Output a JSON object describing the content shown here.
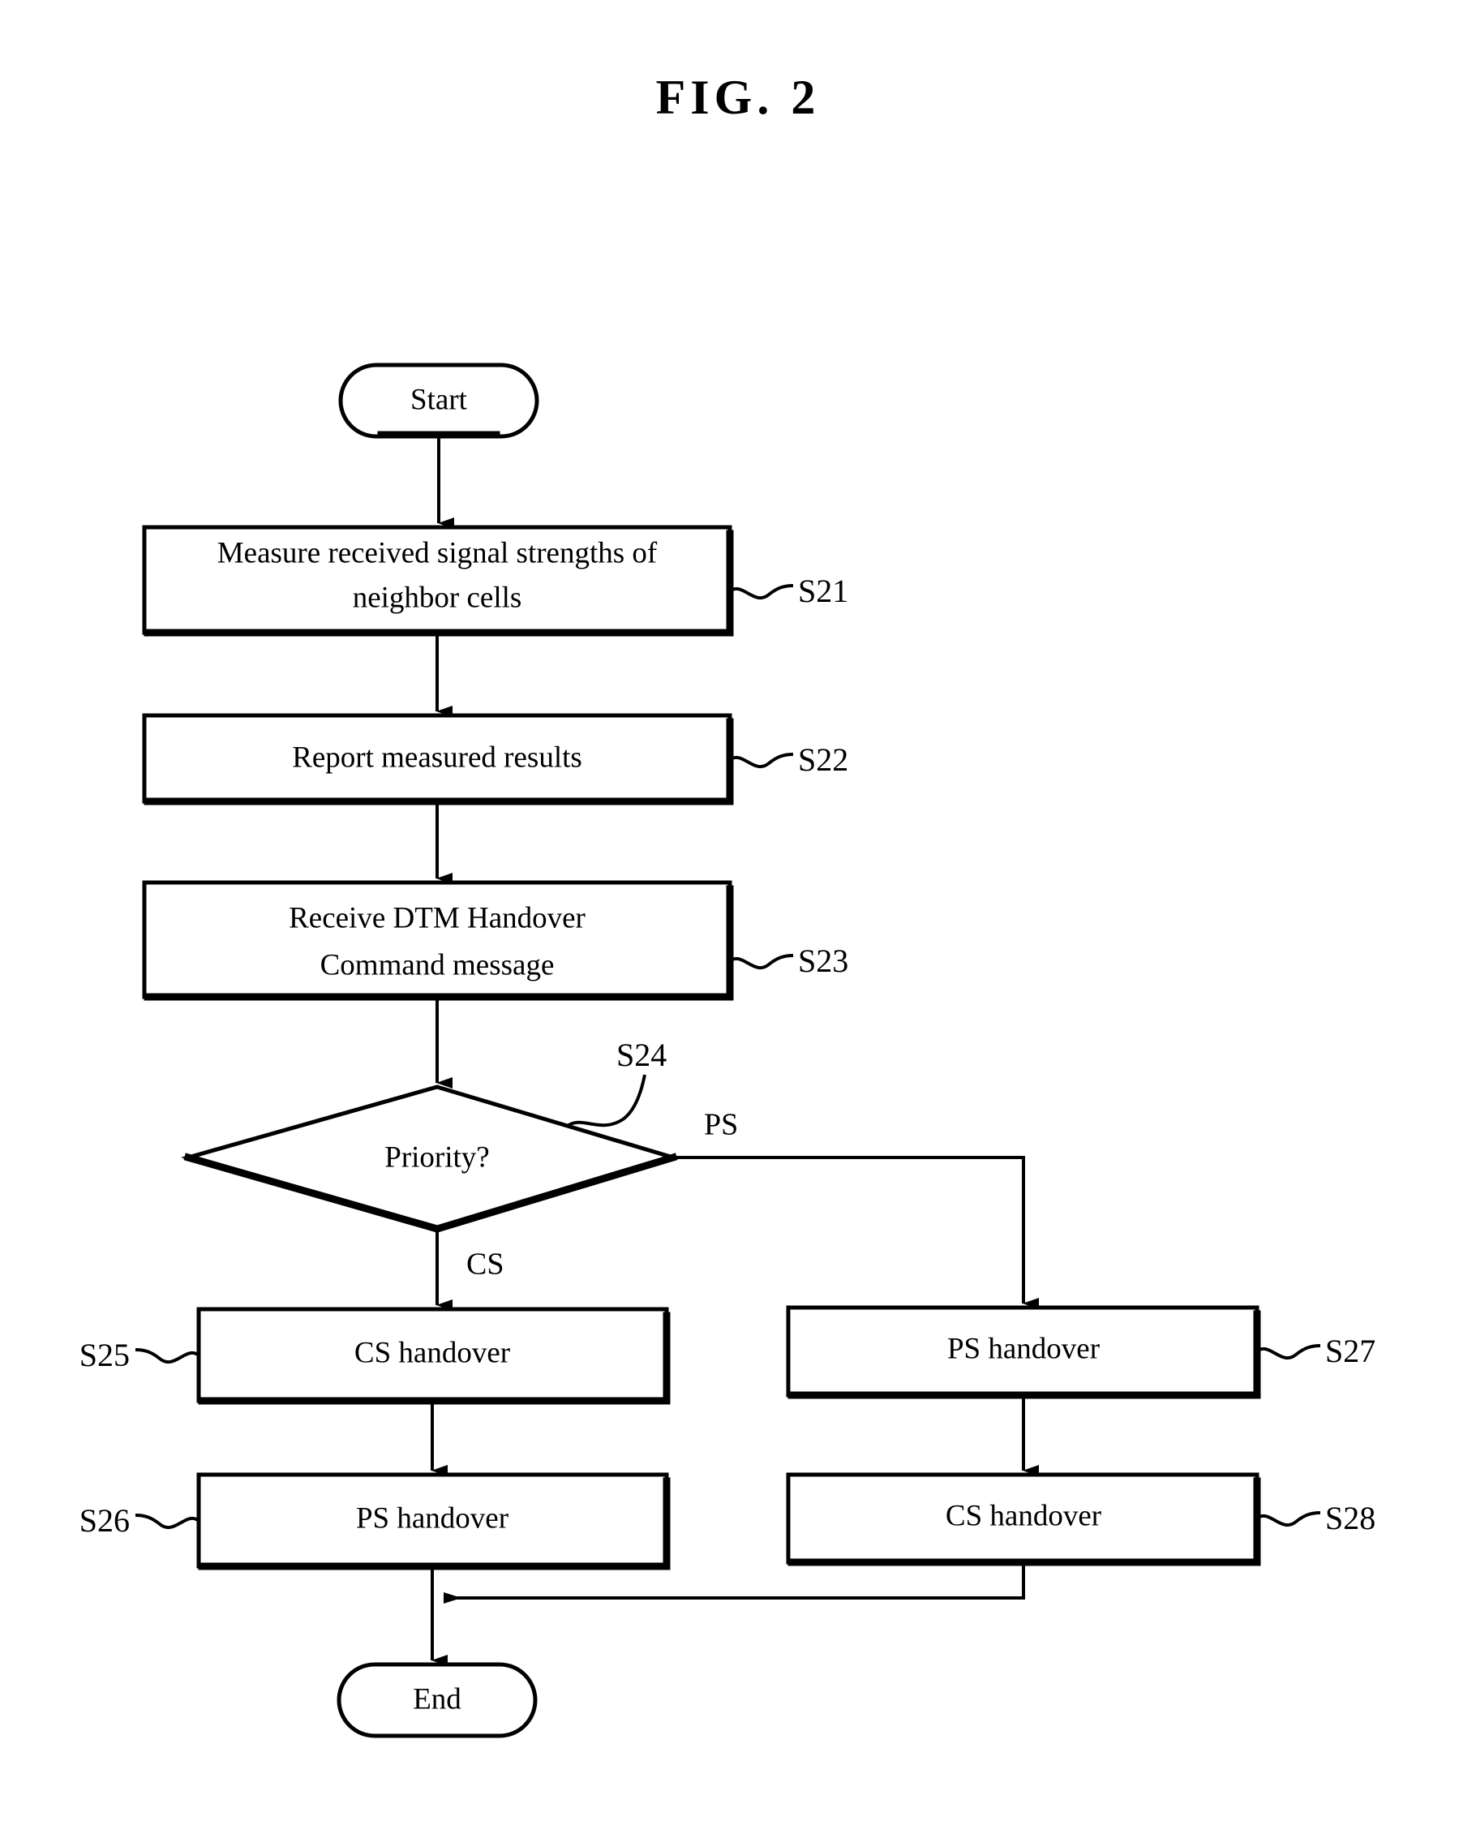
{
  "figure": {
    "title": "FIG. 2",
    "type": "flowchart",
    "domain": "patent-drawing"
  },
  "nodes": [
    {
      "id": "start",
      "shape": "terminator",
      "label": "Start",
      "step": "",
      "step_side": "none"
    },
    {
      "id": "s21",
      "shape": "process",
      "label": "Measure received signal strengths of neighbor cells",
      "line1": "Measure received signal strengths of",
      "line2": "neighbor cells",
      "step": "S21",
      "step_side": "right"
    },
    {
      "id": "s22",
      "shape": "process",
      "label": "Report measured results",
      "line1": "Report measured results",
      "line2": "",
      "step": "S22",
      "step_side": "right"
    },
    {
      "id": "s23",
      "shape": "process",
      "label": "Receive DTM Handover Command message",
      "line1": "Receive DTM Handover",
      "line2": "Command message",
      "step": "S23",
      "step_side": "right"
    },
    {
      "id": "s24",
      "shape": "decision",
      "label": "Priority?",
      "step": "S24",
      "step_side": "leader"
    },
    {
      "id": "s25",
      "shape": "process",
      "label": "CS handover",
      "line1": "CS handover",
      "line2": "",
      "step": "S25",
      "step_side": "left"
    },
    {
      "id": "s26",
      "shape": "process",
      "label": "PS handover",
      "line1": "PS handover",
      "line2": "",
      "step": "S26",
      "step_side": "left"
    },
    {
      "id": "s27",
      "shape": "process",
      "label": "PS handover",
      "line1": "PS handover",
      "line2": "",
      "step": "S27",
      "step_side": "right"
    },
    {
      "id": "s28",
      "shape": "process",
      "label": "CS handover",
      "line1": "CS handover",
      "line2": "",
      "step": "S28",
      "step_side": "right"
    },
    {
      "id": "end",
      "shape": "terminator",
      "label": "End",
      "step": "",
      "step_side": "none"
    }
  ],
  "branches": {
    "cs_label": "CS",
    "ps_label": "PS"
  },
  "colors": {
    "ink": "#000000",
    "paper": "#ffffff"
  }
}
